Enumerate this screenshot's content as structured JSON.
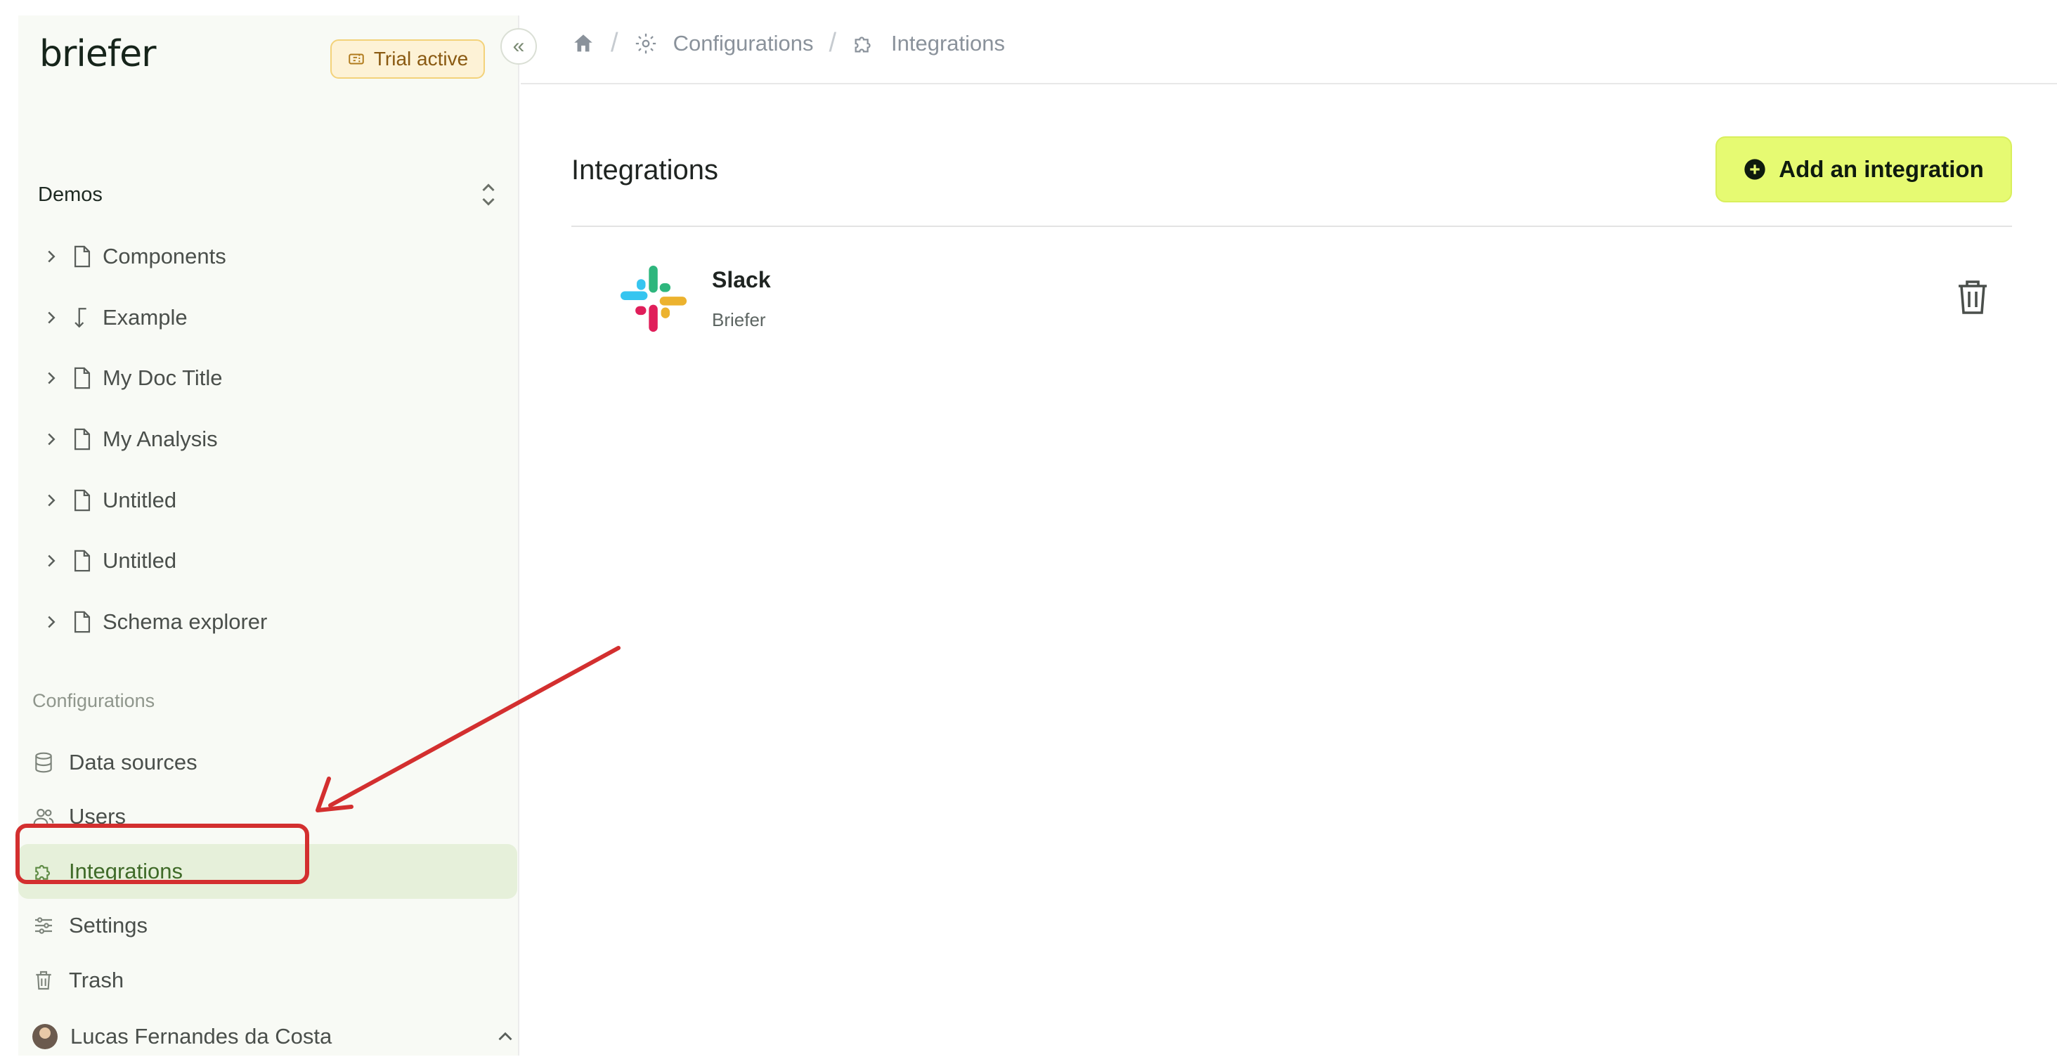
{
  "brand": {
    "logo_text": "briefer"
  },
  "trial": {
    "label": "Trial active",
    "icon": "ticket-icon"
  },
  "sidebar": {
    "workspace": {
      "name": "Demos",
      "icon": "chevron-updown-icon"
    },
    "documents": [
      {
        "label": "Components",
        "icon": "file-icon"
      },
      {
        "label": "Example",
        "icon": "arrow-down-left-icon"
      },
      {
        "label": "My Doc Title",
        "icon": "file-icon"
      },
      {
        "label": "My Analysis",
        "icon": "file-icon"
      },
      {
        "label": "Untitled",
        "icon": "file-icon"
      },
      {
        "label": "Untitled",
        "icon": "file-icon"
      },
      {
        "label": "Schema explorer",
        "icon": "file-icon"
      }
    ],
    "config_heading": "Configurations",
    "config_items": [
      {
        "label": "Data sources",
        "icon": "database-icon"
      },
      {
        "label": "Users",
        "icon": "users-icon"
      },
      {
        "label": "Integrations",
        "icon": "puzzle-icon",
        "active": true
      },
      {
        "label": "Settings",
        "icon": "sliders-icon"
      },
      {
        "label": "Trash",
        "icon": "trash-icon"
      }
    ],
    "user": {
      "name": "Lucas Fernandes da Costa"
    }
  },
  "breadcrumb": {
    "items": [
      {
        "label": "Configurations",
        "icon": "gear-icon"
      },
      {
        "label": "Integrations",
        "icon": "puzzle-icon"
      }
    ]
  },
  "main": {
    "title": "Integrations",
    "add_button_label": "Add an integration",
    "integrations": [
      {
        "name": "Slack",
        "workspace": "Briefer",
        "icon": "slack-icon"
      }
    ]
  },
  "colors": {
    "accent_button": "#e6fa72",
    "active_nav_bg": "#e6f0da",
    "active_nav_text": "#3f6a28",
    "annotation": "#d32f2f",
    "trial_bg": "#fdf2d6"
  }
}
